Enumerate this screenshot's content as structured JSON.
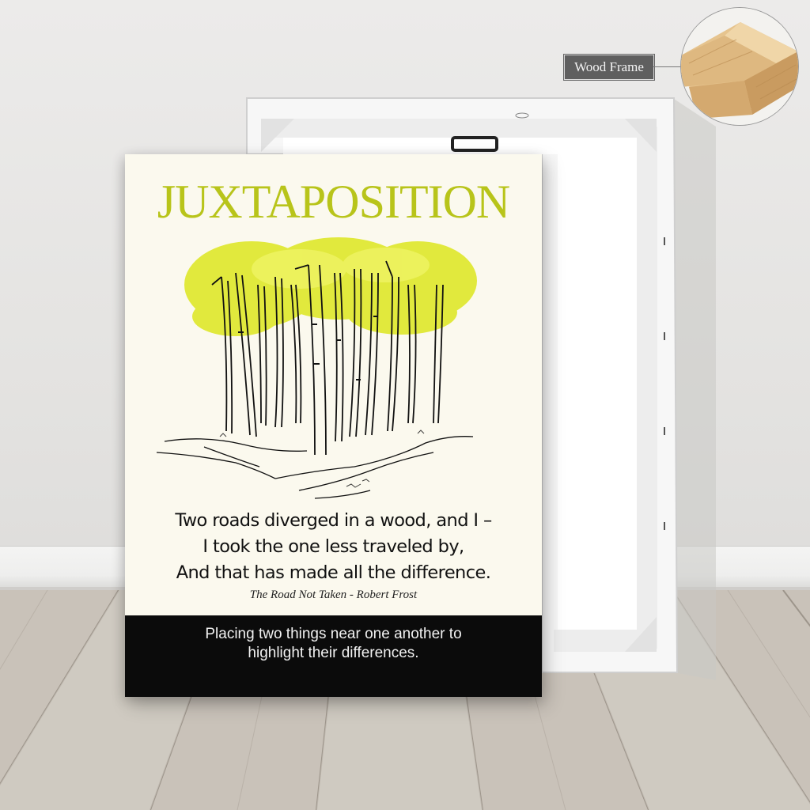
{
  "poster": {
    "title": "JUXTAPOSITION",
    "poem_lines": [
      "Two roads diverged in a wood, and I –",
      "I took the one less traveled by,",
      "And that has made all the difference."
    ],
    "attribution": "The Road Not Taken - Robert Frost",
    "definition_lines": [
      "Placing two things near one another to",
      "highlight their differences."
    ]
  },
  "callout": {
    "label": "Wood Frame"
  },
  "colors": {
    "title": "#b8c41a",
    "foliage": "#dfe82a",
    "poster_bg": "#fbf9ee",
    "footer_bg": "#0b0b0b",
    "wood": "#e2c08c"
  },
  "icons": [
    "tree-illustration",
    "wood-frame-corner-photo"
  ]
}
